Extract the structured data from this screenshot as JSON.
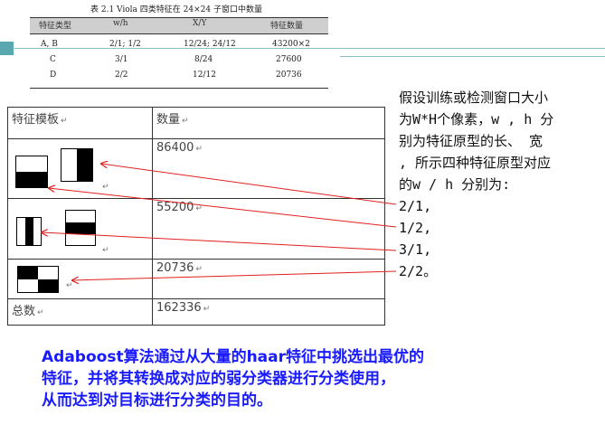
{
  "top_table": {
    "caption": "表 2.1   Viola 四类特征在 24×24 子窗口中数量",
    "headers": [
      "特征类型",
      "w/h",
      "X/Y",
      "特征数量"
    ],
    "rows": [
      [
        "A, B",
        "2/1; 1/2",
        "12/24; 24/12",
        "43200×2"
      ],
      [
        "C",
        "3/1",
        "8/24",
        "27600"
      ],
      [
        "D",
        "2/2",
        "12/12",
        "20736"
      ]
    ]
  },
  "main_table": {
    "header_template": "特征模板",
    "header_count": "数量",
    "rows": [
      {
        "count": "86400"
      },
      {
        "count": "55200"
      },
      {
        "count": "20736"
      }
    ],
    "total_label": "总数",
    "total_value": "162336"
  },
  "right_text": {
    "lines": [
      "假设训练或检测窗口大小",
      "为W*H个像素，w , h 分",
      "别为特征原型的长、 宽",
      ", 所示四种特征原型对应",
      "的w / h 分别为:",
      "2/1,",
      "1/2,",
      "3/1,",
      "2/2。"
    ]
  },
  "bottom_text": {
    "lines": [
      "Adaboost算法通过从大量的haar特征中挑选出最优的",
      "特征，并将其转换成对应的弱分类器进行分类使用，",
      "从而达到对目标进行分类的目的。"
    ]
  },
  "colors": {
    "accent_teal": "#5aa8b0",
    "arrow_red": "#e02020",
    "bottom_text_blue": "#1a1aff"
  }
}
